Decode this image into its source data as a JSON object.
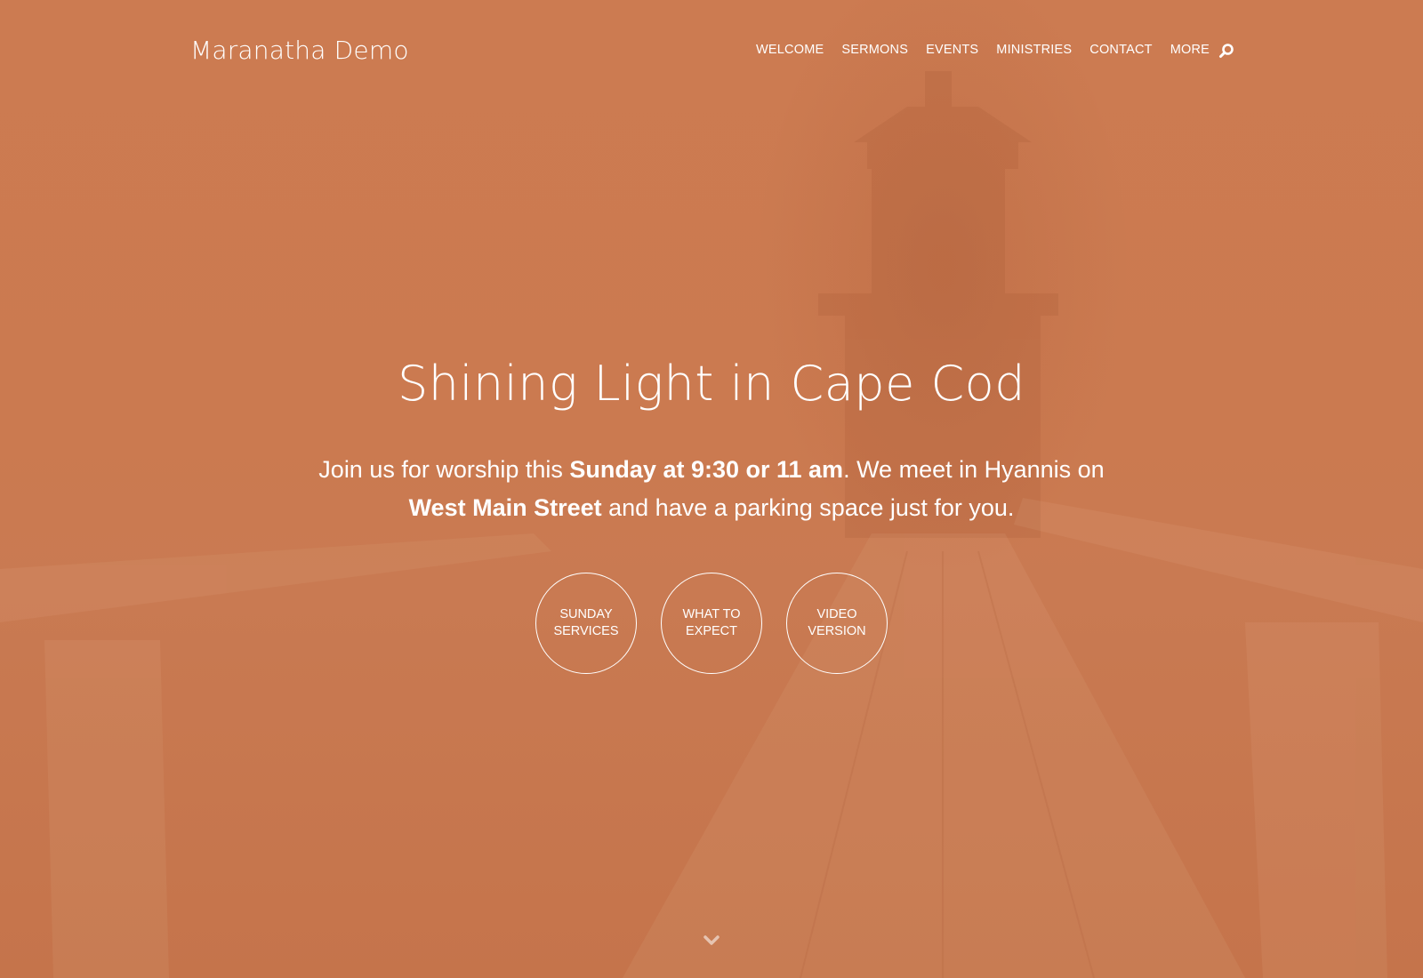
{
  "site": {
    "title": "Maranatha Demo"
  },
  "nav": {
    "items": [
      {
        "label": "WELCOME"
      },
      {
        "label": "SERMONS"
      },
      {
        "label": "EVENTS"
      },
      {
        "label": "MINISTRIES"
      },
      {
        "label": "CONTACT"
      },
      {
        "label": "MORE"
      }
    ],
    "search_icon": "search-icon"
  },
  "hero": {
    "heading": "Shining Light in Cape Cod",
    "tagline": {
      "part1": "Join us for worship this ",
      "bold1": "Sunday at 9:30 or 11 am",
      "part2": ". We meet in Hyannis on ",
      "bold2": "West Main Street",
      "part3": " and have a parking space just for you."
    },
    "buttons": [
      {
        "label": "SUNDAY SERVICES"
      },
      {
        "label": "WHAT TO EXPECT"
      },
      {
        "label": "VIDEO VERSION"
      }
    ],
    "scroll_icon": "chevron-down-icon"
  },
  "colors": {
    "overlay": "#cb7a50",
    "text": "#ffffff"
  }
}
